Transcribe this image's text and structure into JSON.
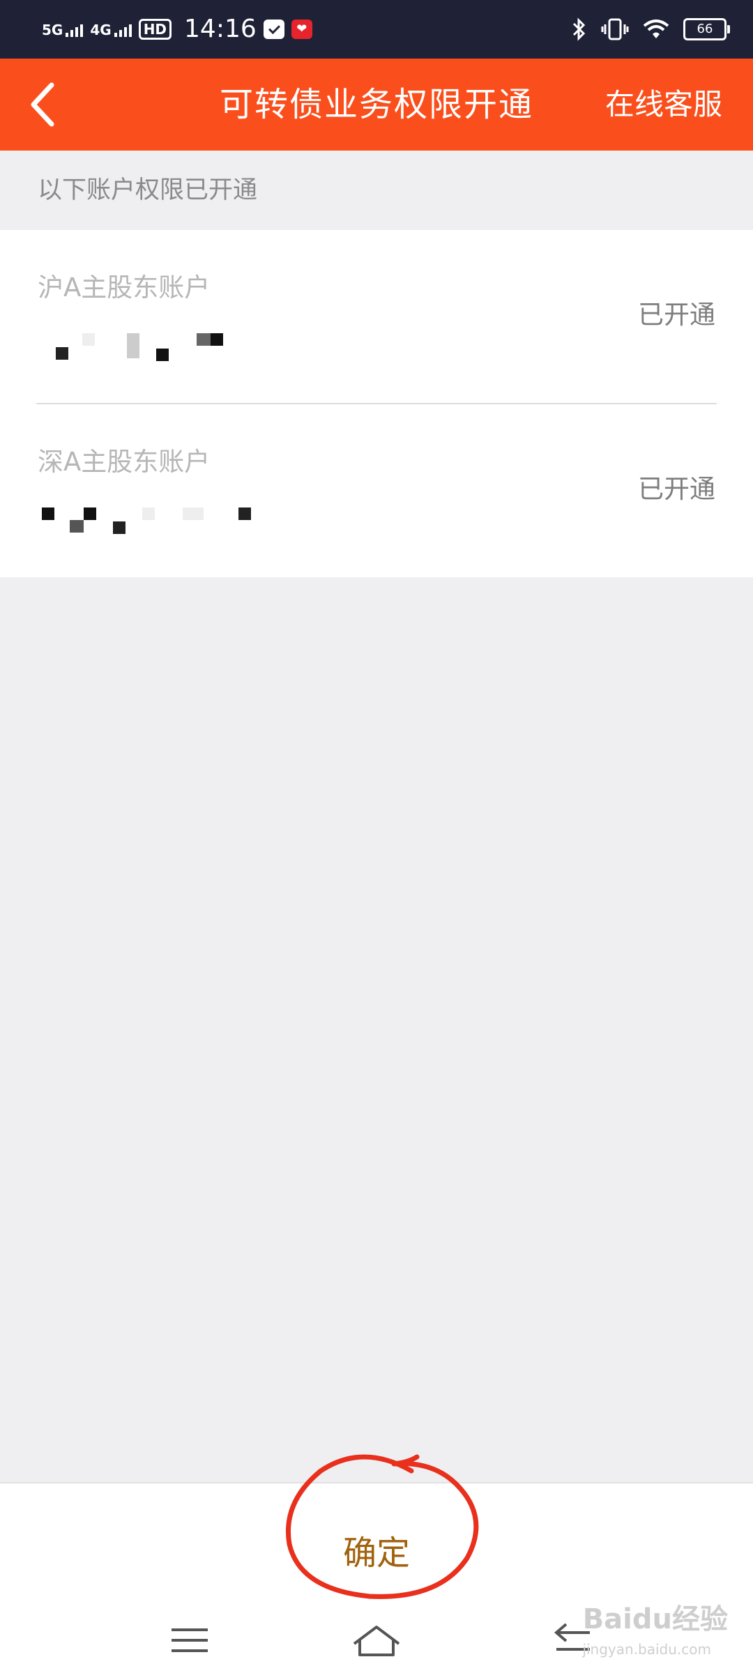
{
  "status_bar": {
    "net1": "5G",
    "net2": "4G",
    "hd": "HD",
    "time": "14:16",
    "battery": "66",
    "icons": [
      "signal-icon",
      "hd-call-icon",
      "message-icon",
      "app-notification-icon",
      "bluetooth-icon",
      "vibrate-icon",
      "wifi-icon",
      "battery-icon"
    ]
  },
  "header": {
    "title": "可转债业务权限开通",
    "service_label": "在线客服",
    "background": "#fa4f1d"
  },
  "notice": "以下账户权限已开通",
  "accounts": [
    {
      "name": "沪A主股东账户",
      "status": "已开通"
    },
    {
      "name": "深A主股东账户",
      "status": "已开通"
    }
  ],
  "footer": {
    "confirm_label": "确定",
    "confirm_color": "#a0620c",
    "annotation_color": "#e8301c"
  },
  "nav": {
    "icons": [
      "menu-icon",
      "home-icon",
      "back-icon"
    ]
  },
  "watermark": {
    "text": "Baidu经验",
    "sub": "jingyan.baidu.com"
  }
}
